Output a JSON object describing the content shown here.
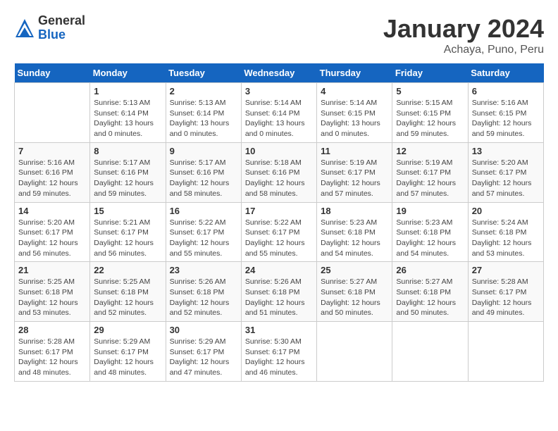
{
  "logo": {
    "general": "General",
    "blue": "Blue"
  },
  "title": "January 2024",
  "location": "Achaya, Puno, Peru",
  "days_of_week": [
    "Sunday",
    "Monday",
    "Tuesday",
    "Wednesday",
    "Thursday",
    "Friday",
    "Saturday"
  ],
  "weeks": [
    [
      {
        "day": "",
        "info": ""
      },
      {
        "day": "1",
        "info": "Sunrise: 5:13 AM\nSunset: 6:14 PM\nDaylight: 13 hours\nand 0 minutes."
      },
      {
        "day": "2",
        "info": "Sunrise: 5:13 AM\nSunset: 6:14 PM\nDaylight: 13 hours\nand 0 minutes."
      },
      {
        "day": "3",
        "info": "Sunrise: 5:14 AM\nSunset: 6:14 PM\nDaylight: 13 hours\nand 0 minutes."
      },
      {
        "day": "4",
        "info": "Sunrise: 5:14 AM\nSunset: 6:15 PM\nDaylight: 13 hours\nand 0 minutes."
      },
      {
        "day": "5",
        "info": "Sunrise: 5:15 AM\nSunset: 6:15 PM\nDaylight: 12 hours\nand 59 minutes."
      },
      {
        "day": "6",
        "info": "Sunrise: 5:16 AM\nSunset: 6:15 PM\nDaylight: 12 hours\nand 59 minutes."
      }
    ],
    [
      {
        "day": "7",
        "info": "Sunrise: 5:16 AM\nSunset: 6:16 PM\nDaylight: 12 hours\nand 59 minutes."
      },
      {
        "day": "8",
        "info": "Sunrise: 5:17 AM\nSunset: 6:16 PM\nDaylight: 12 hours\nand 59 minutes."
      },
      {
        "day": "9",
        "info": "Sunrise: 5:17 AM\nSunset: 6:16 PM\nDaylight: 12 hours\nand 58 minutes."
      },
      {
        "day": "10",
        "info": "Sunrise: 5:18 AM\nSunset: 6:16 PM\nDaylight: 12 hours\nand 58 minutes."
      },
      {
        "day": "11",
        "info": "Sunrise: 5:19 AM\nSunset: 6:17 PM\nDaylight: 12 hours\nand 57 minutes."
      },
      {
        "day": "12",
        "info": "Sunrise: 5:19 AM\nSunset: 6:17 PM\nDaylight: 12 hours\nand 57 minutes."
      },
      {
        "day": "13",
        "info": "Sunrise: 5:20 AM\nSunset: 6:17 PM\nDaylight: 12 hours\nand 57 minutes."
      }
    ],
    [
      {
        "day": "14",
        "info": "Sunrise: 5:20 AM\nSunset: 6:17 PM\nDaylight: 12 hours\nand 56 minutes."
      },
      {
        "day": "15",
        "info": "Sunrise: 5:21 AM\nSunset: 6:17 PM\nDaylight: 12 hours\nand 56 minutes."
      },
      {
        "day": "16",
        "info": "Sunrise: 5:22 AM\nSunset: 6:17 PM\nDaylight: 12 hours\nand 55 minutes."
      },
      {
        "day": "17",
        "info": "Sunrise: 5:22 AM\nSunset: 6:17 PM\nDaylight: 12 hours\nand 55 minutes."
      },
      {
        "day": "18",
        "info": "Sunrise: 5:23 AM\nSunset: 6:18 PM\nDaylight: 12 hours\nand 54 minutes."
      },
      {
        "day": "19",
        "info": "Sunrise: 5:23 AM\nSunset: 6:18 PM\nDaylight: 12 hours\nand 54 minutes."
      },
      {
        "day": "20",
        "info": "Sunrise: 5:24 AM\nSunset: 6:18 PM\nDaylight: 12 hours\nand 53 minutes."
      }
    ],
    [
      {
        "day": "21",
        "info": "Sunrise: 5:25 AM\nSunset: 6:18 PM\nDaylight: 12 hours\nand 53 minutes."
      },
      {
        "day": "22",
        "info": "Sunrise: 5:25 AM\nSunset: 6:18 PM\nDaylight: 12 hours\nand 52 minutes."
      },
      {
        "day": "23",
        "info": "Sunrise: 5:26 AM\nSunset: 6:18 PM\nDaylight: 12 hours\nand 52 minutes."
      },
      {
        "day": "24",
        "info": "Sunrise: 5:26 AM\nSunset: 6:18 PM\nDaylight: 12 hours\nand 51 minutes."
      },
      {
        "day": "25",
        "info": "Sunrise: 5:27 AM\nSunset: 6:18 PM\nDaylight: 12 hours\nand 50 minutes."
      },
      {
        "day": "26",
        "info": "Sunrise: 5:27 AM\nSunset: 6:18 PM\nDaylight: 12 hours\nand 50 minutes."
      },
      {
        "day": "27",
        "info": "Sunrise: 5:28 AM\nSunset: 6:17 PM\nDaylight: 12 hours\nand 49 minutes."
      }
    ],
    [
      {
        "day": "28",
        "info": "Sunrise: 5:28 AM\nSunset: 6:17 PM\nDaylight: 12 hours\nand 48 minutes."
      },
      {
        "day": "29",
        "info": "Sunrise: 5:29 AM\nSunset: 6:17 PM\nDaylight: 12 hours\nand 48 minutes."
      },
      {
        "day": "30",
        "info": "Sunrise: 5:29 AM\nSunset: 6:17 PM\nDaylight: 12 hours\nand 47 minutes."
      },
      {
        "day": "31",
        "info": "Sunrise: 5:30 AM\nSunset: 6:17 PM\nDaylight: 12 hours\nand 46 minutes."
      },
      {
        "day": "",
        "info": ""
      },
      {
        "day": "",
        "info": ""
      },
      {
        "day": "",
        "info": ""
      }
    ]
  ]
}
